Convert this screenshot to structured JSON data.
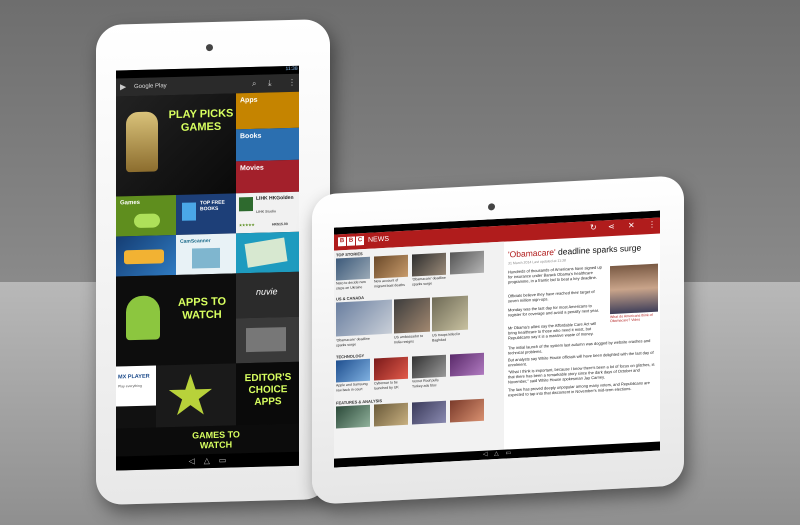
{
  "tablet_play": {
    "app_title": "Google Play",
    "status_time": "11:38",
    "tiles": {
      "play_picks": "PLAY PICKS GAMES",
      "apps": "Apps",
      "books": "Books",
      "movies": "Movies",
      "games": "Games",
      "top_free_books": "TOP FREE BOOKS",
      "lihk_name": "LIHK HKGolden",
      "lihk_dev": "LIHK Studio",
      "lihk_price": "HK$15.00",
      "apps_to_watch": "APPS TO WATCH",
      "mx_player": "MX PLAYER",
      "mx_sub": "Play everything",
      "editors_choice": "EDITOR'S CHOICE APPS",
      "games_to_watch": "GAMES TO WATCH",
      "camscanner": "CamScanner",
      "nuvie": "nuvie"
    }
  },
  "tablet_bbc": {
    "brand_letters": [
      "B",
      "B",
      "C"
    ],
    "brand_news": "NEWS",
    "top_stories_label": "TOP STORIES",
    "us_canada_label": "US & CANADA",
    "technology_label": "TECHNOLOGY",
    "features_label": "FEATURES & ANALYSIS",
    "headline_prefix": "'Obamacare'",
    "headline_rest": " deadline sparks surge",
    "article_date": "31 March 2014 Last updated at 11:38",
    "image_caption": "What do Americans think of Obamacare? Video",
    "paragraphs": [
      "Hundreds of thousands of Americans have signed up for insurance under Barack Obama's healthcare programme, in a frantic bid to beat a key deadline.",
      "Officials believe they have reached their target of seven million sign-ups.",
      "Monday was the last day for most Americans to register for coverage and avoid a penalty next year.",
      "Mr Obama's allies say the Affordable Care Act will bring healthcare to those who need it most, but Republicans say it is a massive waste of money.",
      "The initial launch of the system last autumn was dogged by website crashes and technical problems.",
      "But analysts say White House officials will have been delighted with the last day of enrolment.",
      "\"What I think is important, because I know there's been a lot of focus on glitches, is that there has been a remarkable story since the dark days of October and November,\" said White House spokesman Jay Carney.",
      "The law has proved deeply unpopular among many voters, and Republicans are expected to tap into that discontent in November's mid-term elections."
    ],
    "top_captions": [
      "Nato to decide new steps on Ukraine",
      "New account of migrant boat deaths",
      "'Obamacare' deadline sparks surge"
    ],
    "us_captions": [
      "'Obamacare' deadline sparks surge",
      "US ambassador to India resigns",
      "US troops killed in Baghdad"
    ],
    "tech_captions": [
      "Apple and Samsung row back in court",
      "Cyberwar to be launched by UK",
      "Vernet Roof pulls Turkey ads bloc"
    ]
  }
}
